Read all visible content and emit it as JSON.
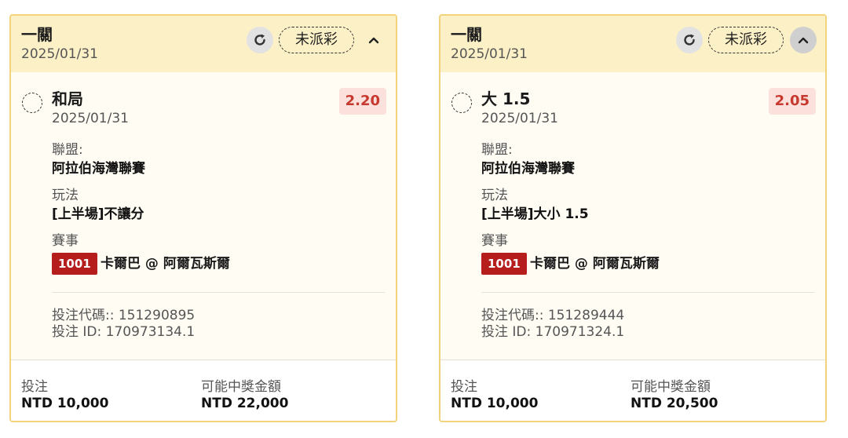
{
  "cards": [
    {
      "bet_type": "一關",
      "date": "2025/01/31",
      "status": "未派彩",
      "selection": "和局",
      "selection_date": "2025/01/31",
      "odds": "2.20",
      "league_label": "聯盟:",
      "league": "阿拉伯海灣聯賽",
      "market_label": "玩法",
      "market": "[上半場]不讓分",
      "event_label": "賽事",
      "match_id": "1001",
      "match": "卡爾巴 @ 阿爾瓦斯爾",
      "bet_code": "投注代碼:: 151290895",
      "bet_id": "投注 ID: 170973134.1",
      "stake_label": "投注",
      "stake": "NTD 10,000",
      "payout_label": "可能中獎金額",
      "payout": "NTD 22,000",
      "refresh_icon": "refresh-icon",
      "collapse_icon": "chevron-up-icon"
    },
    {
      "bet_type": "一關",
      "date": "2025/01/31",
      "status": "未派彩",
      "selection": "大 1.5",
      "selection_date": "2025/01/31",
      "odds": "2.05",
      "league_label": "聯盟:",
      "league": "阿拉伯海灣聯賽",
      "market_label": "玩法",
      "market": "[上半場]大小 1.5",
      "event_label": "賽事",
      "match_id": "1001",
      "match": "卡爾巴 @ 阿爾瓦斯爾",
      "bet_code": "投注代碼:: 151289444",
      "bet_id": "投注 ID: 170971324.1",
      "stake_label": "投注",
      "stake": "NTD 10,000",
      "payout_label": "可能中獎金額",
      "payout": "NTD 20,500",
      "refresh_icon": "refresh-icon",
      "collapse_icon": "chevron-up-icon"
    }
  ],
  "colors": {
    "header_bg": "#fcf0c6",
    "card_border": "#f2d27a",
    "odds_text": "#c7392f",
    "odds_bg": "#fbe0dc",
    "match_id_bg": "#b61d1d"
  }
}
